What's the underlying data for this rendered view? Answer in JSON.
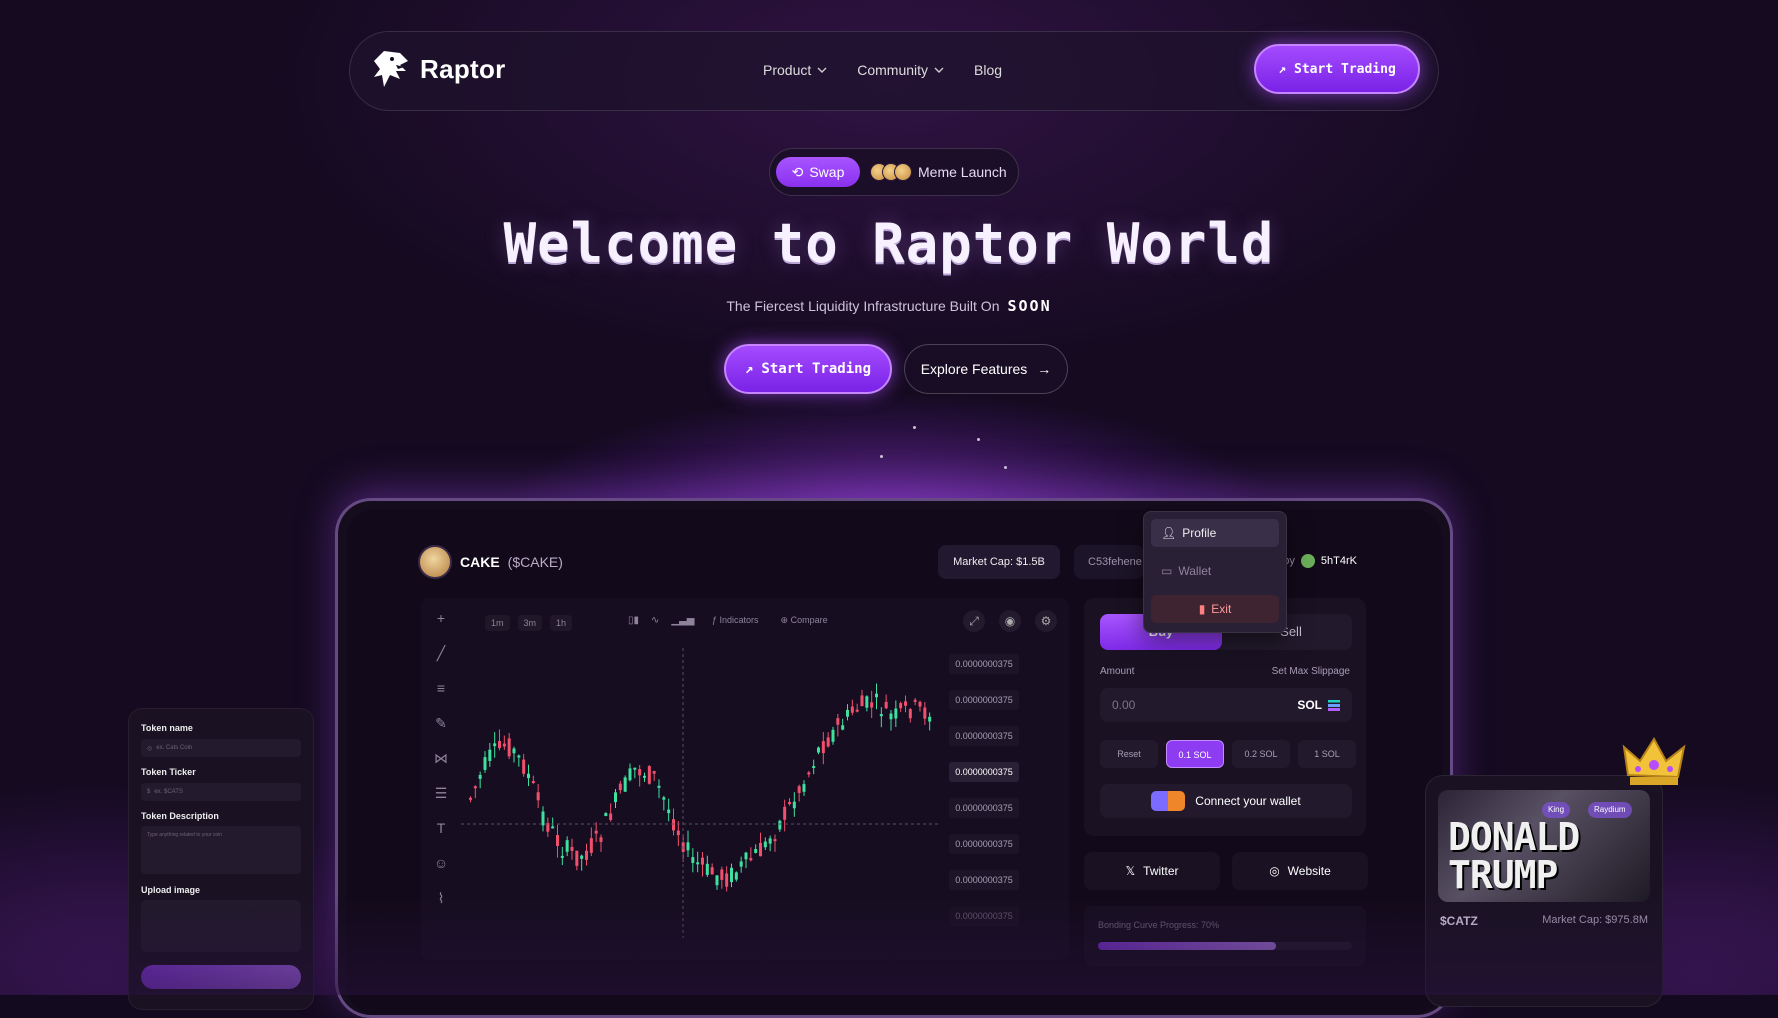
{
  "nav": {
    "brand": "Raptor",
    "menu": [
      {
        "label": "Product",
        "has_dropdown": true
      },
      {
        "label": "Community",
        "has_dropdown": true
      },
      {
        "label": "Blog",
        "has_dropdown": false
      }
    ],
    "cta": "Start Trading"
  },
  "pills": {
    "swap": "Swap",
    "meme": "Meme Launch"
  },
  "hero": {
    "title": "Welcome to Raptor World",
    "subtitle": "The Fiercest Liquidity Infrastructure Built On",
    "subtitle_brand": "SOON",
    "primary_cta": "Start Trading",
    "secondary_cta": "Explore Features"
  },
  "dashboard": {
    "token_name": "CAKE",
    "token_ticker": "($CAKE)",
    "market_cap": "Market Cap: $1.5B",
    "address": "C53fehene",
    "created_by_prefix": "ed by",
    "creator": "5hT4rK",
    "dropdown": [
      "Profile",
      "Wallet",
      "Exit"
    ],
    "chart": {
      "timeframes": [
        "1m",
        "3m",
        "1h"
      ],
      "indicators_label": "Indicators",
      "compare_label": "Compare",
      "price_labels": [
        "0.0000000375",
        "0.0000000375",
        "0.0000000375",
        "0.0000000375",
        "0.0000000375",
        "0.0000000375",
        "0.0000000375",
        "0.0000000375"
      ]
    },
    "trade": {
      "buy": "Buy",
      "sell": "Sell",
      "amount_label": "Amount",
      "slippage_label": "Set Max Slippage",
      "amount_placeholder": "0.00",
      "currency": "SOL",
      "quick": [
        "Reset",
        "0.1 SOL",
        "0.2 SOL",
        "1 SOL"
      ],
      "quick_selected": "0.1 SOL",
      "connect": "Connect your wallet"
    },
    "links": {
      "twitter": "Twitter",
      "website": "Website"
    },
    "bonding": {
      "label": "Bonding Curve Progress: 70%",
      "progress": 0.7
    }
  },
  "form": {
    "name_label": "Token name",
    "name_placeholder": "ex. Cats Coin",
    "ticker_label": "Token Ticker",
    "ticker_placeholder": "ex. $CATS",
    "desc_label": "Token Description",
    "desc_placeholder": "Type anything related to your coin",
    "upload_label": "Upload image"
  },
  "card": {
    "image_text": "DONALD TRUMP",
    "badge_king": "King",
    "badge_raydium": "Raydium",
    "ticker": "$CATZ",
    "market_cap": "Market Cap: $975.8M"
  },
  "colors": {
    "accent": "#9a3cf5",
    "background": "#150a20"
  }
}
